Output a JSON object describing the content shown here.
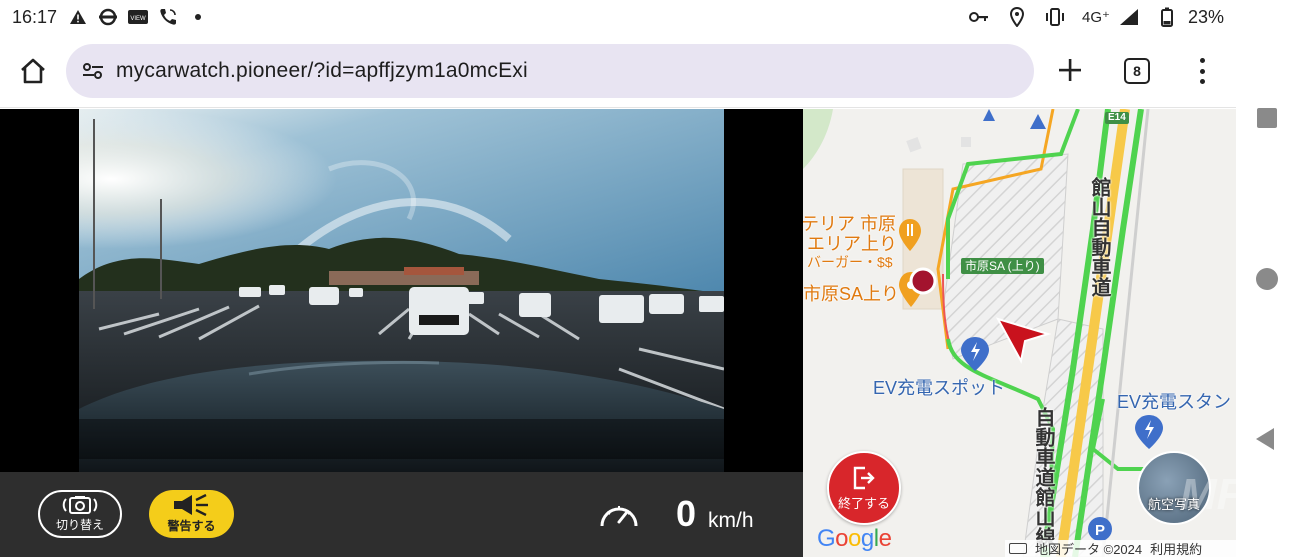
{
  "status_bar": {
    "time": "16:17",
    "left_icons": [
      "warning-icon",
      "tube-icon",
      "view-icon",
      "wifi-call-icon",
      "dot-icon"
    ],
    "right_icons": [
      "vpn-key-icon",
      "location-icon",
      "vibrate-icon",
      "4g-icon",
      "signal-icon",
      "battery-icon"
    ],
    "network": "4G⁺",
    "battery": "23%"
  },
  "browser": {
    "url": "mycarwatch.pioneer/?id=apffjzym1a0mcExi",
    "tab_count": "8"
  },
  "controls": {
    "switch_label": "切り替え",
    "warn_label": "警告する",
    "speed_value": "0",
    "speed_unit": "km/h",
    "warn_color": "#f4cd1a"
  },
  "map": {
    "labels": {
      "terrace": "テリア 市原",
      "area_up": "エリア上り",
      "burger": "バーガー・$$",
      "ichihara_sa": "市原SA上り",
      "ichihara_sa_tag": "市原SA (上り)",
      "ev_station": "EV充電スポット",
      "ev_station_2": "EV充電スタン",
      "expressway_top": "館山自動車道",
      "expressway_bottom": "自動車道館山線",
      "route_tag": "E14"
    },
    "end_button": "終了する",
    "aerial_button": "航空写真",
    "google": "Google",
    "attribution": "地図データ ©2024",
    "terms": "利用規約"
  },
  "watermark": "MF"
}
